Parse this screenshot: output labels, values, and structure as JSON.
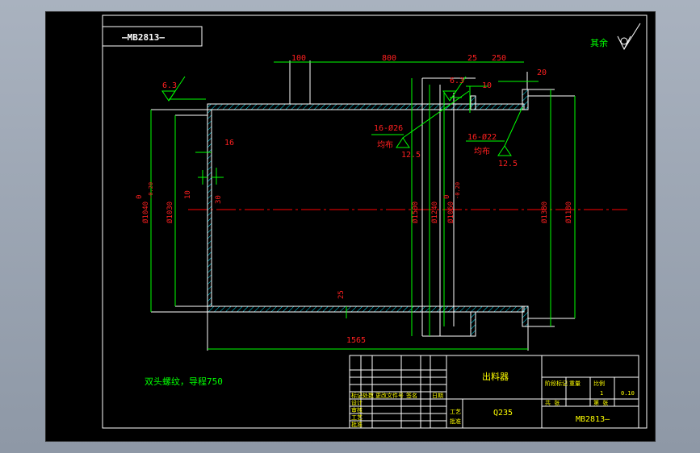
{
  "drawing": {
    "code_box": "—MB2813—",
    "roughness_note": "其余",
    "note_text": "双头螺纹，导程750",
    "dimensions": {
      "d100": "100",
      "d800": "800",
      "d25_top": "25",
      "d250": "250",
      "d20": "20",
      "d10": "10",
      "d16": "16",
      "d10_left": "10",
      "d30": "30",
      "d25_bottom": "25",
      "d1565": "1565",
      "phi1040": "Ø1040",
      "tol_upper": "0",
      "tol_lower": "-0.20",
      "phi1030": "Ø1030",
      "phi1500": "Ø1500",
      "phi1240": "Ø1240",
      "phi1060": "Ø1060",
      "phi1380": "Ø1380",
      "phi1180": "Ø1180"
    },
    "roughness": {
      "r63_left": "6.3",
      "r63_mid": "6.3",
      "r125_a": "12.5",
      "r125_b": "12.5"
    },
    "holes": {
      "h26": "16-Ø26",
      "h26_note": "均布",
      "h22": "16-Ø22",
      "h22_note": "均布"
    }
  },
  "title_block": {
    "part_name": "出料器",
    "material": "Q235",
    "drawing_no": "MB2813—",
    "scale_value": "1",
    "weight_value": "0.10",
    "cells": {
      "design": "设计",
      "check": "审核",
      "process": "工艺",
      "approve": "批准",
      "mark": "标记",
      "count": "处数",
      "file": "更改文件号",
      "sign": "签名",
      "date": "日期",
      "stage_mark": "阶段标记",
      "weight": "重量",
      "ratio": "比例",
      "sheet_total": "共 张",
      "sheet_no": "第 张"
    }
  },
  "colors": {
    "background": "#000000",
    "outline": "#ffffff",
    "dimension": "#ff2020",
    "leader": "#00ff00",
    "centerline": "#ff0000",
    "hatch": "#00e5ff",
    "table_text": "#ffff00"
  }
}
